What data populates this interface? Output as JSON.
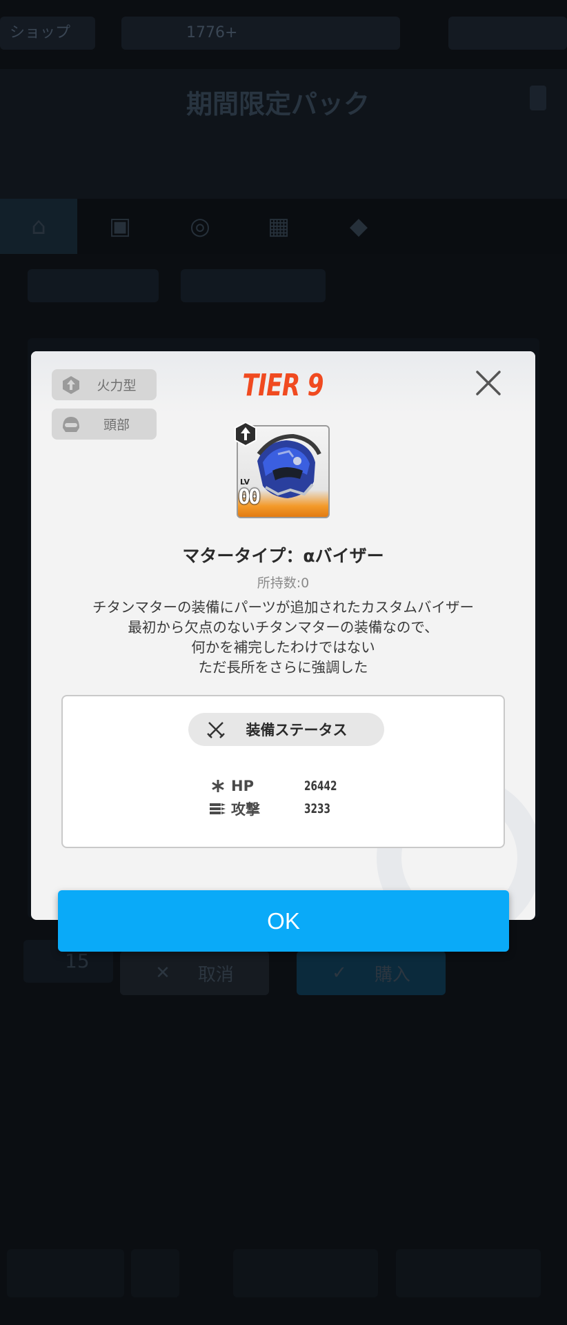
{
  "background": {
    "topbar": [
      "ショップ",
      "1776+",
      "",
      ""
    ],
    "banner_title": "期間限定パック",
    "banner_subtitle": "",
    "banner_remaining": "",
    "price": "15",
    "cancel_label": "取消",
    "buy_label": "購入"
  },
  "modal": {
    "type_chips": [
      {
        "label": "火力型",
        "icon": "firepower-type-icon"
      },
      {
        "label": "頭部",
        "icon": "head-part-icon"
      }
    ],
    "tier": "TIER 9",
    "item": {
      "level": "00",
      "name": "マタータイプ：αバイザー",
      "owned": "所持数:0",
      "description": [
        "チタンマターの装備にパーツが追加されたカスタムバイザー",
        "最初から欠点のないチタンマターの装備なので、",
        "何かを補完したわけではない",
        "ただ長所をさらに強調した"
      ]
    },
    "status": {
      "header": "装備ステータス",
      "stats": [
        {
          "label": "HP",
          "value": "26442",
          "icon": "hp-icon"
        },
        {
          "label": "攻撃",
          "value": "3233",
          "icon": "attack-icon"
        }
      ]
    },
    "ok_label": "OK"
  },
  "colors": {
    "tier": "#f04a20",
    "ok_button": "#0aaaf8",
    "modal_bg": "#f3f3f3"
  }
}
